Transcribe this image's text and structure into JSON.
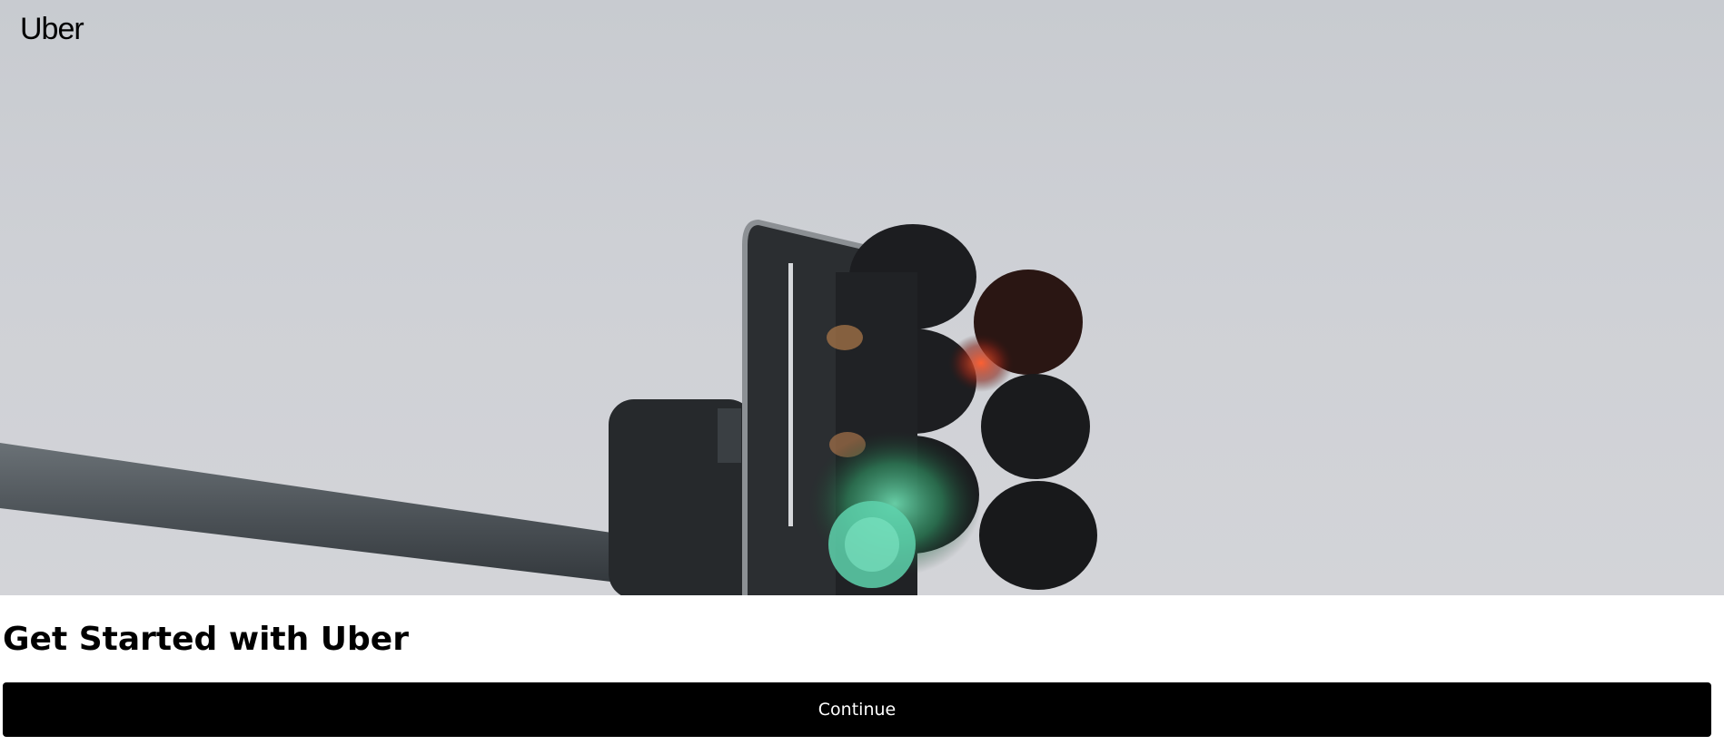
{
  "brand": {
    "logo_text": "Uber"
  },
  "hero": {
    "image_icon": "traffic-light-photo"
  },
  "main": {
    "title": "Get Started with Uber",
    "continue_label": "Continue"
  },
  "colors": {
    "button_background": "#000000",
    "button_text": "#ffffff",
    "sky": "#cbcdd2"
  }
}
